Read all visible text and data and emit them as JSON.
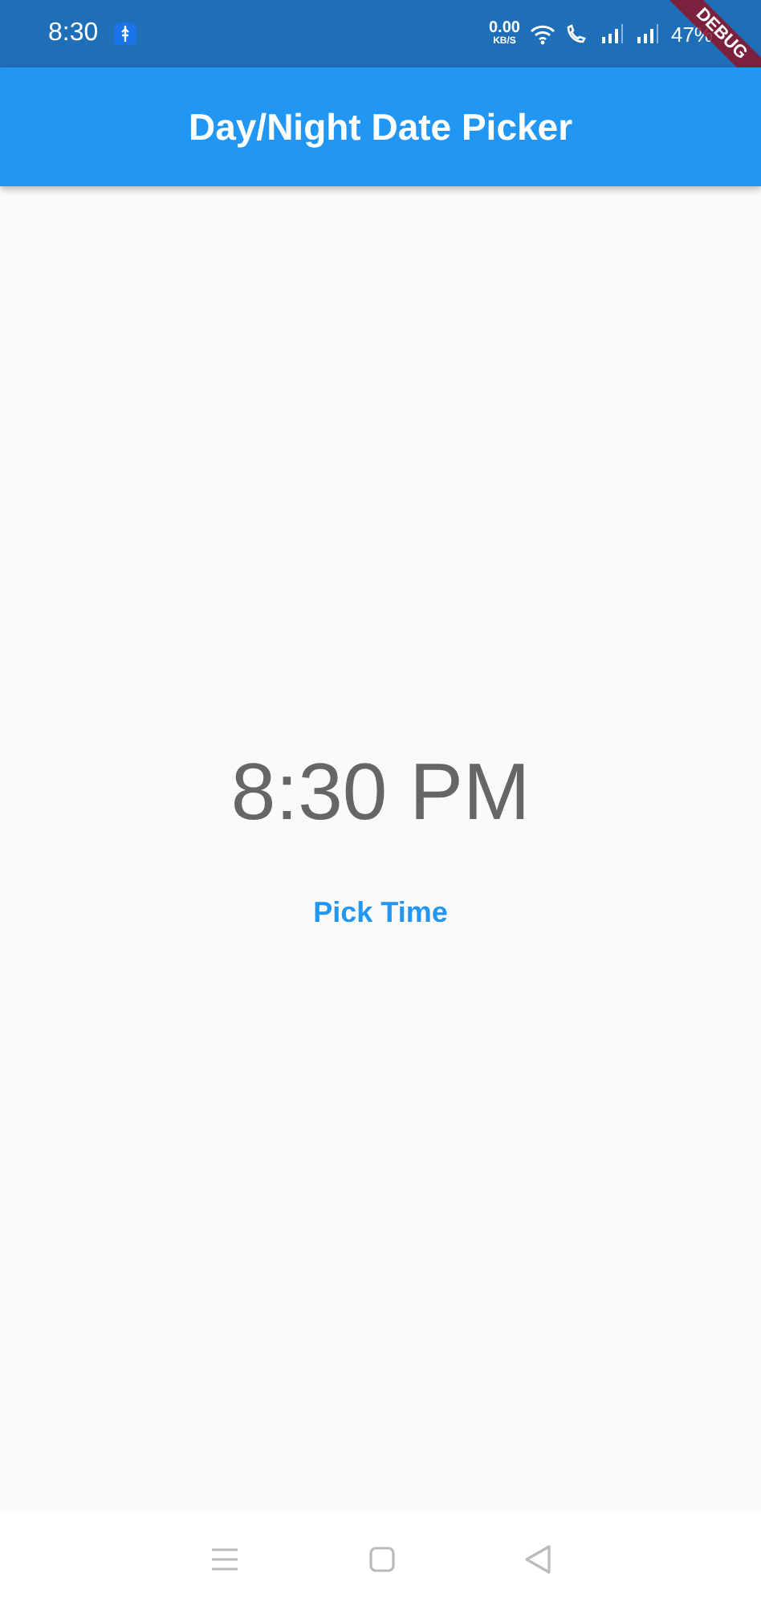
{
  "status_bar": {
    "time": "8:30",
    "speed_value": "0.00",
    "speed_unit": "KB/S",
    "battery": "47%"
  },
  "debug_banner": "DEBUG",
  "app_bar": {
    "title": "Day/Night Date Picker"
  },
  "time_display": "8:30 PM",
  "pick_button": "Pick Time"
}
